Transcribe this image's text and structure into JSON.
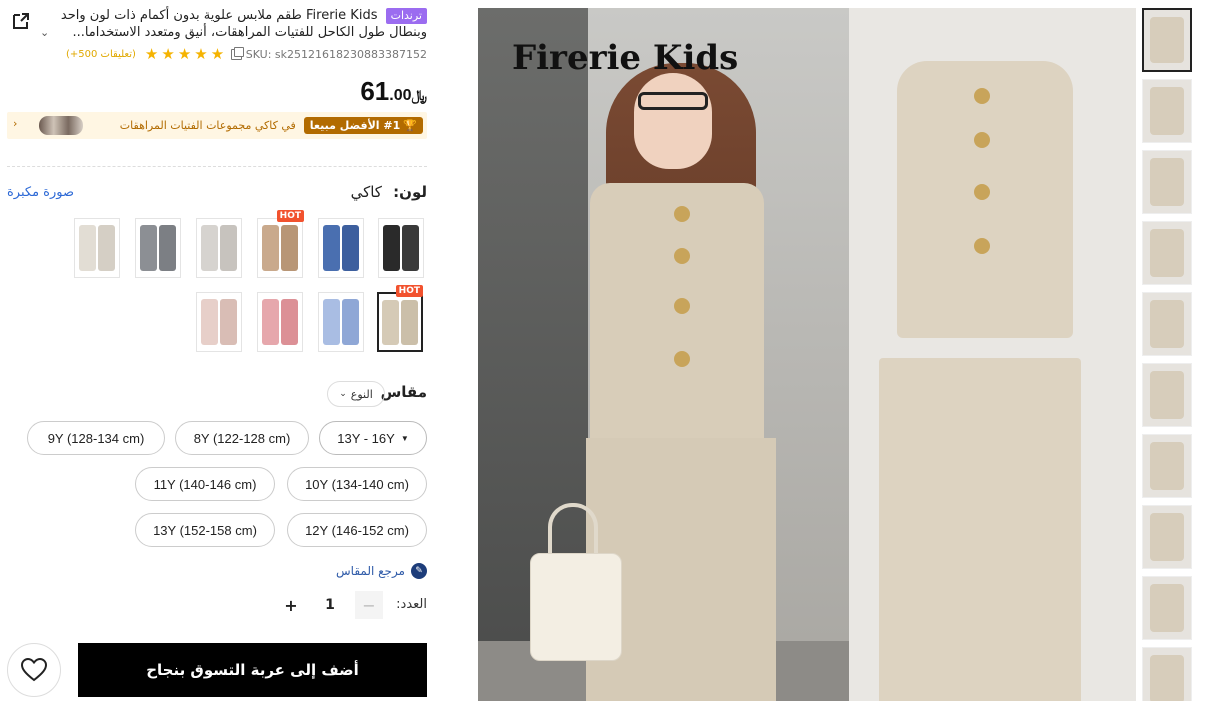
{
  "header": {
    "trend_badge": "ترندات",
    "title": "Firerie Kids طقم ملابس علوية بدون أكمام ذات لون واحد وبنطال طول الكاحل للفتيات المراهقات، أنيق ومتعدد الاستخداما...",
    "sku": "SKU: sk25121618230883387152",
    "rating_count": "(+500 تعليقات)",
    "stars": 5
  },
  "price": {
    "currency": "﷼",
    "integer": "61",
    "decimal": ".00"
  },
  "best_seller": {
    "badge": "#1 الأفضل مبيعا",
    "text": "في كاكي مجموعات الفتيات المراهقات"
  },
  "color": {
    "label": "لون:",
    "value": "كاكي",
    "bigger_image_link": "صورة مكبرة",
    "hot_label": "HOT",
    "swatches": [
      {
        "a": "#2a2a2a",
        "b": "#3a3a3a"
      },
      {
        "a": "#4a6fb0",
        "b": "#3d5f9e"
      },
      {
        "a": "#c9a98c",
        "b": "#b89676"
      },
      {
        "a": "#d6d3cf",
        "b": "#c7c3be"
      },
      {
        "a": "#8c8f94",
        "b": "#7c7f84"
      },
      {
        "a": "#e2ddd4",
        "b": "#d5cfc5"
      },
      {
        "a": "#d5cab6",
        "b": "#cbbfa9"
      },
      {
        "a": "#a9bde3",
        "b": "#8fa7d6"
      },
      {
        "a": "#e6a7ac",
        "b": "#dc9096"
      },
      {
        "a": "#e7cfc9",
        "b": "#d9bdb5"
      }
    ]
  },
  "size": {
    "label": "مقاس",
    "type_select": "النوع",
    "options": [
      "13Y - 16Y",
      "8Y (122-128 cm)",
      "9Y (128-134 cm)",
      "10Y (134-140 cm)",
      "11Y (140-146 cm)",
      "12Y (146-152 cm)",
      "13Y (152-158 cm)"
    ],
    "guide": "مرجع المقاس"
  },
  "quantity": {
    "label": "العدد:",
    "value": "1"
  },
  "cart": {
    "add_label": "أضف إلى عربة التسوق بنجاح"
  },
  "image": {
    "brand_text": "Firerie Kids"
  }
}
